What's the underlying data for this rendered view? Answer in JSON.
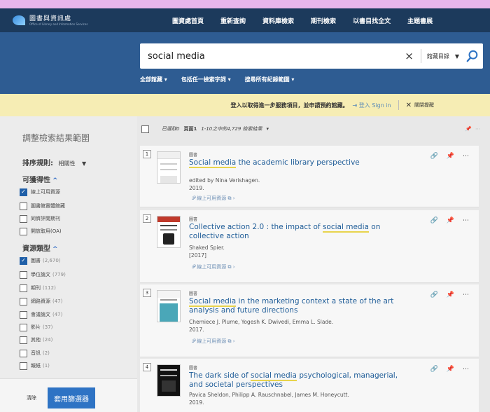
{
  "topnav": {
    "logo_text": "圖書與資訊處",
    "logo_sub": "Office of Library and Information Services",
    "links": [
      "圖資處首頁",
      "重新查詢",
      "資料庫檢索",
      "期刊檢索",
      "以書目找全文",
      "主題書展"
    ]
  },
  "search": {
    "query": "social media",
    "clear": "×",
    "scope": "館藏目錄",
    "options": [
      "全部館藏 ▾",
      "包括任一檢索字詞 ▾",
      "搜尋所有紀錄範圍 ▾"
    ]
  },
  "signin_bar": {
    "text": "登入以取得進一步服務項目，並申請預約館藏。",
    "sign_in": "登入 Sign in",
    "dismiss": "關閉提醒"
  },
  "sidebar": {
    "title": "調整檢索結果範圍",
    "sort_label": "排序規則:",
    "sort_value": "相關性",
    "availability": {
      "heading": "可獲得性",
      "items": [
        {
          "label": "線上可用資源",
          "checked": true
        },
        {
          "label": "圖書館實體館藏",
          "checked": false
        },
        {
          "label": "同儕評閱期刊",
          "checked": false
        },
        {
          "label": "開放取用(OA)",
          "checked": false
        }
      ]
    },
    "resource_type": {
      "heading": "資源類型",
      "items": [
        {
          "label": "圖書",
          "count": "(2,670)",
          "checked": true
        },
        {
          "label": "學位論文",
          "count": "(779)",
          "checked": false
        },
        {
          "label": "期刊",
          "count": "(112)",
          "checked": false
        },
        {
          "label": "網路資源",
          "count": "(47)",
          "checked": false
        },
        {
          "label": "會議論文",
          "count": "(47)",
          "checked": false
        },
        {
          "label": "影片",
          "count": "(37)",
          "checked": false
        },
        {
          "label": "其他",
          "count": "(24)",
          "checked": false
        },
        {
          "label": "音訊",
          "count": "(2)",
          "checked": false
        },
        {
          "label": "報紙",
          "count": "(1)",
          "checked": false
        }
      ]
    },
    "clear": "清除",
    "apply": "套用篩選器"
  },
  "results_toolbar": {
    "selected": "已選取0",
    "page": "頁面1",
    "range": "1-10之中的4,729 檢索結果",
    "dd": "▾"
  },
  "results": [
    {
      "num": "1",
      "type": "圖書",
      "title_hl": "Social media",
      "title_rest": " the academic library perspective",
      "meta": [
        "edited by Nina Verishagen.",
        "2019."
      ],
      "online": "線上可用資源"
    },
    {
      "num": "2",
      "type": "圖書",
      "title_pre": "Collective action 2.0 : the impact of ",
      "title_hl": "social media",
      "title_rest": " on collective action",
      "meta": [
        "Shaked Spier.",
        "[2017]"
      ],
      "online": "線上可用資源"
    },
    {
      "num": "3",
      "type": "圖書",
      "title_hl": "Social media",
      "title_rest": " in the marketing context a state of the art analysis and future directions",
      "meta": [
        "Chemiece J. Plume, Yogesh K. Dwivedi, Emma L. Slade.",
        "2017."
      ],
      "online": "線上可用資源"
    },
    {
      "num": "4",
      "type": "圖書",
      "title_pre": "The dark side of ",
      "title_hl": "social media",
      "title_rest": " psychological, managerial, and societal perspectives",
      "meta": [
        "Pavica Sheldon, Philipp A. Rauschnabel, James M. Honeycutt.",
        "2019."
      ]
    }
  ],
  "icons": {
    "link": "🔗",
    "pin": "📌",
    "more": "⋯"
  }
}
